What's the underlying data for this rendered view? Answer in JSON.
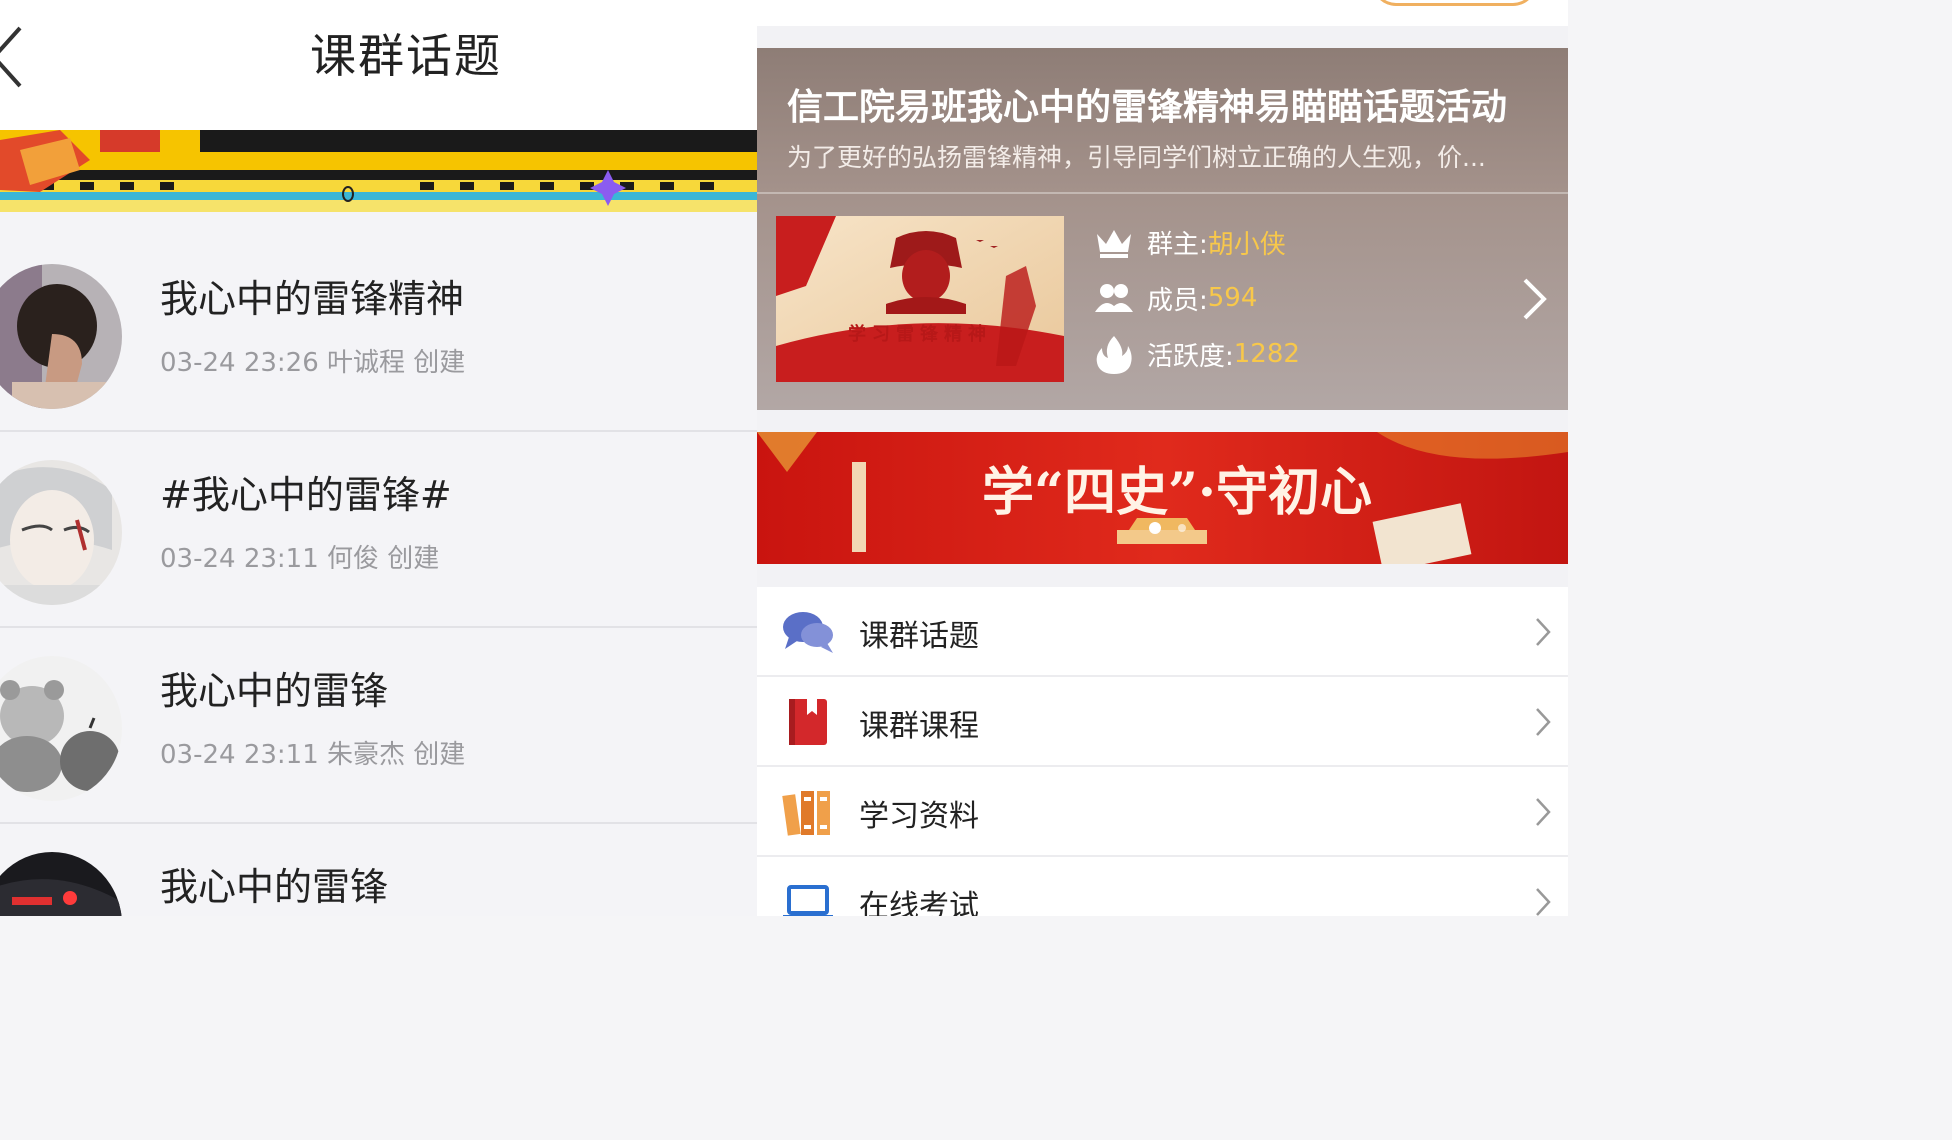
{
  "header": {
    "title": "课群话题"
  },
  "topics": [
    {
      "title": "我心中的雷锋精神",
      "meta": "03-24 23:26 叶诚程 创建"
    },
    {
      "title": "#我心中的雷锋#",
      "meta": "03-24 23:11 何俊 创建"
    },
    {
      "title": "我心中的雷锋",
      "meta": "03-24 23:11 朱豪杰 创建"
    },
    {
      "title": "我心中的雷锋",
      "meta": ""
    }
  ],
  "group": {
    "title": "信工院易班我心中的雷锋精神易瞄瞄话题活动",
    "description": "为了更好的弘扬雷锋精神，引导同学们树立正确的人生观，价...",
    "cover_text": "学习雷锋精神",
    "owner_label": "群主:",
    "owner_value": "胡小侠",
    "members_label": "成员:",
    "members_value": "594",
    "activity_label": "活跃度:",
    "activity_value": "1282"
  },
  "banner": {
    "text": "学“四史”·守初心"
  },
  "menu": [
    {
      "label": "课群话题",
      "icon": "chat-bubbles-icon"
    },
    {
      "label": "课群课程",
      "icon": "book-icon"
    },
    {
      "label": "学习资料",
      "icon": "binders-icon"
    },
    {
      "label": "在线考试",
      "icon": "laptop-icon"
    }
  ],
  "colors": {
    "accent_value": "#f8c84a",
    "banner_red": "#d9201a",
    "promo_yellow": "#f6c400"
  }
}
